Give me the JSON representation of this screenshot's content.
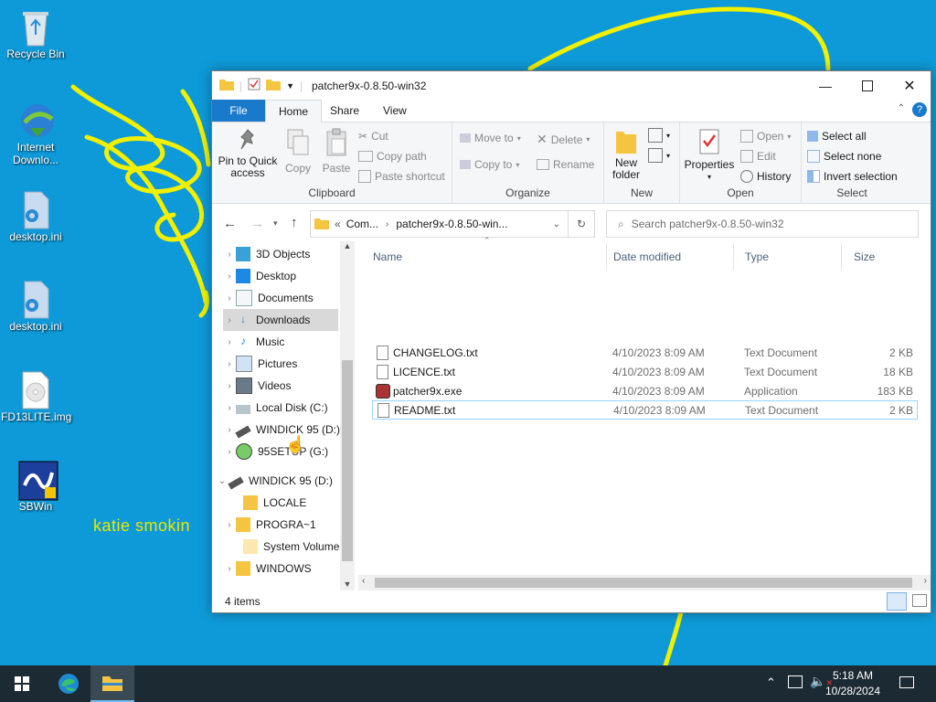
{
  "desktop": {
    "icons": [
      {
        "label": "Recycle Bin"
      },
      {
        "label": "Internet Downlo..."
      },
      {
        "label": "desktop.ini"
      },
      {
        "label": "desktop.ini"
      },
      {
        "label": "FD13LITE.img"
      },
      {
        "label": "SBWin"
      }
    ],
    "overlay_text": "katie smokin",
    "scribble_color": "#f0f000"
  },
  "window": {
    "title": "patcher9x-0.8.50-win32",
    "tabs": {
      "file": "File",
      "home": "Home",
      "share": "Share",
      "view": "View"
    },
    "ribbon": {
      "clipboard": {
        "label": "Clipboard",
        "pin": "Pin to Quick access",
        "copy": "Copy",
        "paste": "Paste",
        "cut": "Cut",
        "copy_path": "Copy path",
        "paste_shortcut": "Paste shortcut"
      },
      "organize": {
        "label": "Organize",
        "move_to": "Move to",
        "copy_to": "Copy to",
        "delete": "Delete",
        "rename": "Rename"
      },
      "new": {
        "label": "New",
        "new_folder": "New folder"
      },
      "open": {
        "label": "Open",
        "properties": "Properties",
        "open": "Open",
        "edit": "Edit",
        "history": "History"
      },
      "select": {
        "label": "Select",
        "select_all": "Select all",
        "select_none": "Select none",
        "invert_selection": "Invert selection"
      }
    },
    "address": {
      "prefix": "«",
      "crumb1": "Com...",
      "crumb2": "patcher9x-0.8.50-win..."
    },
    "search_placeholder": "Search patcher9x-0.8.50-win32",
    "nav_tree": [
      {
        "label": "3D Objects",
        "icon": "3d-objects-icon"
      },
      {
        "label": "Desktop",
        "icon": "desktop-icon"
      },
      {
        "label": "Documents",
        "icon": "documents-icon"
      },
      {
        "label": "Downloads",
        "icon": "downloads-icon",
        "selected": true
      },
      {
        "label": "Music",
        "icon": "music-icon"
      },
      {
        "label": "Pictures",
        "icon": "pictures-icon"
      },
      {
        "label": "Videos",
        "icon": "videos-icon"
      },
      {
        "label": "Local Disk (C:)",
        "icon": "local-disk-icon"
      },
      {
        "label": "WINDICK 95 (D:)",
        "icon": "usb-drive-icon"
      },
      {
        "label": "95SETUP (G:)",
        "icon": "cd-drive-icon"
      },
      {
        "label": "WINDICK 95 (D:)",
        "icon": "usb-drive-icon",
        "expanded": true
      },
      {
        "label": "LOCALE",
        "icon": "folder-icon"
      },
      {
        "label": "PROGRA~1",
        "icon": "folder-icon"
      },
      {
        "label": "System Volume I",
        "icon": "folder-icon"
      },
      {
        "label": "WINDOWS",
        "icon": "folder-icon"
      }
    ],
    "columns": {
      "name": "Name",
      "date": "Date modified",
      "type": "Type",
      "size": "Size"
    },
    "files": [
      {
        "name": "CHANGELOG.txt",
        "date": "4/10/2023 8:09 AM",
        "type": "Text Document",
        "size": "2 KB"
      },
      {
        "name": "LICENCE.txt",
        "date": "4/10/2023 8:09 AM",
        "type": "Text Document",
        "size": "18 KB"
      },
      {
        "name": "patcher9x.exe",
        "date": "4/10/2023 8:09 AM",
        "type": "Application",
        "size": "183 KB"
      },
      {
        "name": "README.txt",
        "date": "4/10/2023 8:09 AM",
        "type": "Text Document",
        "size": "2 KB"
      }
    ],
    "status": "4 items"
  },
  "taskbar": {
    "time": "5:18 AM",
    "date": "10/28/2024"
  },
  "colors": {
    "desktop": "#0e9ad8",
    "accent": "#1979ca",
    "taskbar": "#1c2a33"
  }
}
